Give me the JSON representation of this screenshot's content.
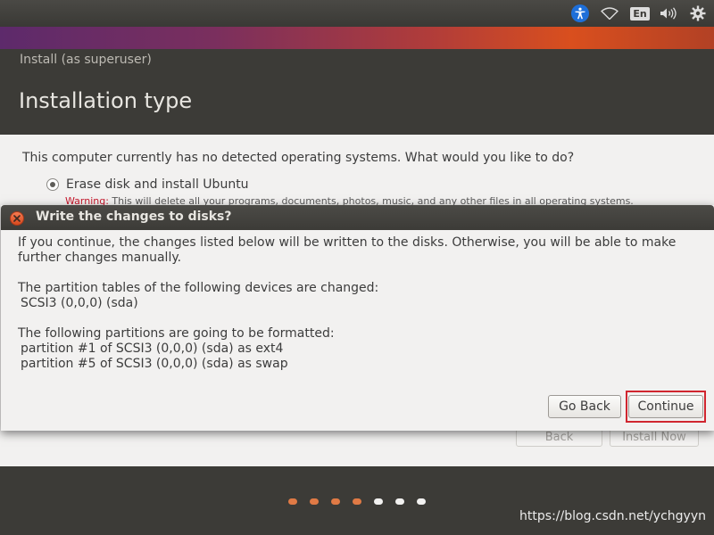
{
  "top_panel": {
    "tray": {
      "accessibility_icon": "accessibility-icon",
      "wifi_icon": "wifi-icon",
      "language": "En",
      "volume_icon": "volume-icon",
      "settings_icon": "gear-icon"
    }
  },
  "installer": {
    "window_title": "Install (as superuser)",
    "page_title": "Installation type",
    "question": "This computer currently has no detected operating systems. What would you like to do?",
    "option_erase": "Erase disk and install Ubuntu",
    "warning_label": "Warning:",
    "warning_text": " This will delete all your programs, documents, photos, music, and any other files in all operating systems.",
    "back_button": "Back",
    "install_button": "Install Now",
    "progress": {
      "completed_steps": 4,
      "total_steps": 7
    }
  },
  "dialog": {
    "title": "Write the changes to disks?",
    "intro": "If you continue, the changes listed below will be written to the disks. Otherwise, you will be able to make further changes manually.",
    "partition_tables_heading": "The partition tables of the following devices are changed:",
    "partition_tables": [
      " SCSI3 (0,0,0) (sda)"
    ],
    "formatted_heading": "The following partitions are going to be formatted:",
    "formatted": [
      " partition #1 of SCSI3 (0,0,0) (sda) as ext4",
      " partition #5 of SCSI3 (0,0,0) (sda) as swap"
    ],
    "go_back_button": "Go Back",
    "continue_button": "Continue"
  },
  "watermark": "https://blog.csdn.net/ychgyyn",
  "colors": {
    "accent_orange": "#e07a45",
    "highlight_red": "#d0262f",
    "panel_dark": "#3c3b37"
  }
}
